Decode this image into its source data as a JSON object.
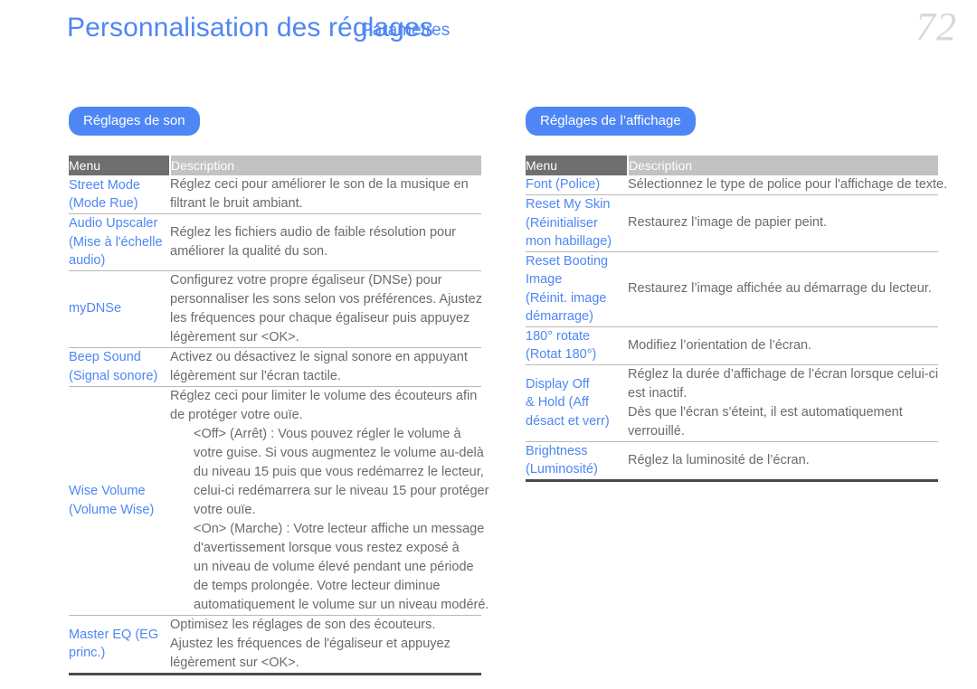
{
  "header": {
    "title": "Personnalisation des réglages",
    "title_overlay": "Paramètres",
    "page_number": "72",
    "accent_color": "#4e87f5",
    "menu_header_bg": "#6f6f6f",
    "desc_header_bg": "#c2c2c2"
  },
  "sections": [
    {
      "pill_label": "Réglages de son",
      "columns": {
        "menu": "Menu",
        "description": "Description"
      },
      "rows": [
        {
          "menu": [
            "Street Mode",
            "(Mode Rue)"
          ],
          "desc": [
            "Réglez ceci pour améliorer le son de la musique en",
            "filtrant le bruit ambiant."
          ],
          "indent": []
        },
        {
          "menu": [
            "Audio Upscaler",
            "(Mise à l'échelle",
            "audio)"
          ],
          "desc": [
            "Réglez les fichiers audio de faible résolution pour",
            "améliorer la qualité du son."
          ],
          "indent": []
        },
        {
          "menu": [
            "myDNSe"
          ],
          "desc": [
            "Configurez votre propre égaliseur (DNSe) pour",
            "personnaliser les sons selon vos préférences. Ajustez",
            "les fréquences pour chaque égaliseur puis appuyez",
            "légèrement sur <OK>."
          ],
          "indent": []
        },
        {
          "menu": [
            "Beep Sound",
            "(Signal sonore)"
          ],
          "desc": [
            "Activez ou désactivez le signal sonore en appuyant",
            "légèrement sur l'écran tactile."
          ],
          "indent": []
        },
        {
          "menu": [
            "Wise Volume",
            "(Volume Wise)"
          ],
          "desc": [
            "Réglez ceci pour limiter le volume des écouteurs afin",
            "de protéger votre ouïe.",
            "<Off> (Arrêt) : Vous pouvez régler le volume à",
            "votre guise. Si vous augmentez le volume au-delà",
            "du niveau 15 puis que vous redémarrez le lecteur,",
            "celui-ci redémarrera sur le niveau 15 pour protéger",
            "votre ouïe.",
            "<On> (Marche) : Votre lecteur affiche un message",
            "d'avertissement lorsque vous restez exposé à",
            "un niveau de volume élevé pendant une période",
            "de temps prolongée. Votre lecteur diminue",
            "automatiquement le volume sur un niveau modéré."
          ],
          "indent": [
            2,
            3,
            4,
            5,
            6,
            7,
            8,
            9,
            10,
            11
          ]
        },
        {
          "menu": [
            "Master EQ (EG",
            "princ.)"
          ],
          "desc": [
            "Optimisez les réglages de son des écouteurs.",
            "Ajustez les fréquences de l'égaliseur et appuyez",
            "légèrement sur <OK>."
          ],
          "indent": []
        }
      ]
    },
    {
      "pill_label": "Réglages de l’affichage",
      "columns": {
        "menu": "Menu",
        "description": "Description"
      },
      "rows": [
        {
          "menu": [
            "Font  (Police)"
          ],
          "desc": [
            "Sélectionnez le type de police pour l'affichage de texte."
          ],
          "indent": []
        },
        {
          "menu": [
            "Reset My Skin",
            "(Réinitialiser",
            "mon habillage)"
          ],
          "desc": [
            "Restaurez l’image de papier peint."
          ],
          "indent": []
        },
        {
          "menu": [
            "Reset Booting",
            "Image",
            "(Réinit. image",
            "démarrage)"
          ],
          "desc": [
            "Restaurez l’image affichée au démarrage du lecteur."
          ],
          "indent": []
        },
        {
          "menu": [
            "180° rotate",
            "(Rotat 180°)"
          ],
          "desc": [
            "Modifiez l’orientation de l’écran."
          ],
          "indent": []
        },
        {
          "menu": [
            "Display Off",
            "& Hold (Aff",
            "désact et verr)"
          ],
          "desc": [
            "Réglez la durée d’affichage de l’écran lorsque celui-ci",
            "est inactif.",
            "Dès que l'écran s'éteint, il est automatiquement",
            "verrouillé."
          ],
          "indent": []
        },
        {
          "menu": [
            "Brightness",
            "(Luminosité)"
          ],
          "desc": [
            "Réglez la luminosité de l’écran."
          ],
          "indent": []
        }
      ]
    }
  ]
}
